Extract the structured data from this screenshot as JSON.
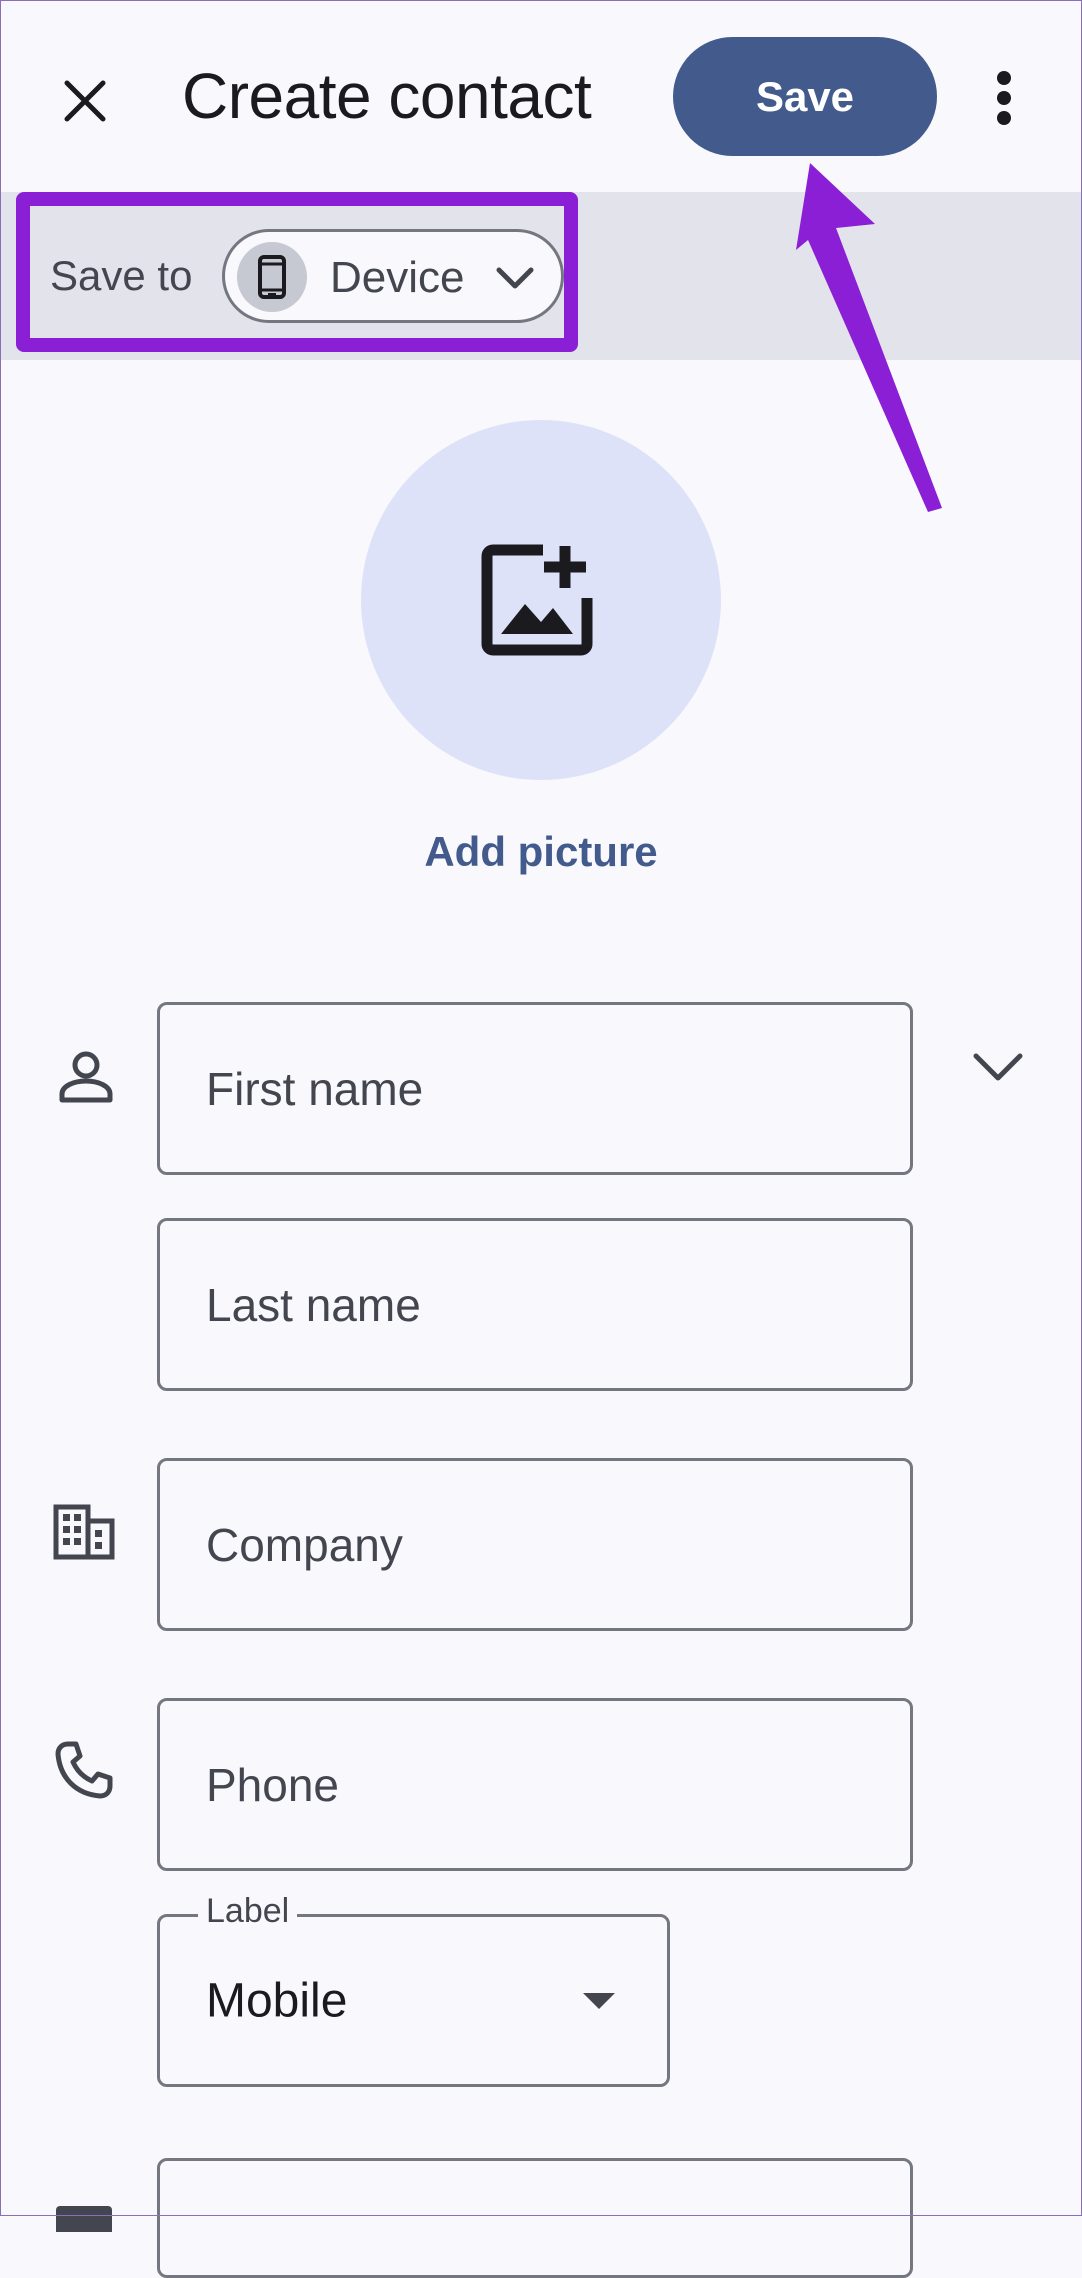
{
  "header": {
    "title": "Create contact",
    "save_label": "Save",
    "close_icon": "close-icon",
    "more_icon": "more-vert-icon"
  },
  "save_to": {
    "label": "Save to",
    "account": "Device",
    "account_icon": "phone-icon"
  },
  "photo": {
    "add_label": "Add picture",
    "icon": "add-photo-icon"
  },
  "form": {
    "first_name_placeholder": "First name",
    "last_name_placeholder": "Last name",
    "company_placeholder": "Company",
    "phone_placeholder": "Phone",
    "phone_label_legend": "Label",
    "phone_label_value": "Mobile"
  },
  "colors": {
    "primary": "#425a8c",
    "annotation": "#8a1fd6",
    "background": "#f8f8fd",
    "avatar_bg": "#dde2f8"
  }
}
